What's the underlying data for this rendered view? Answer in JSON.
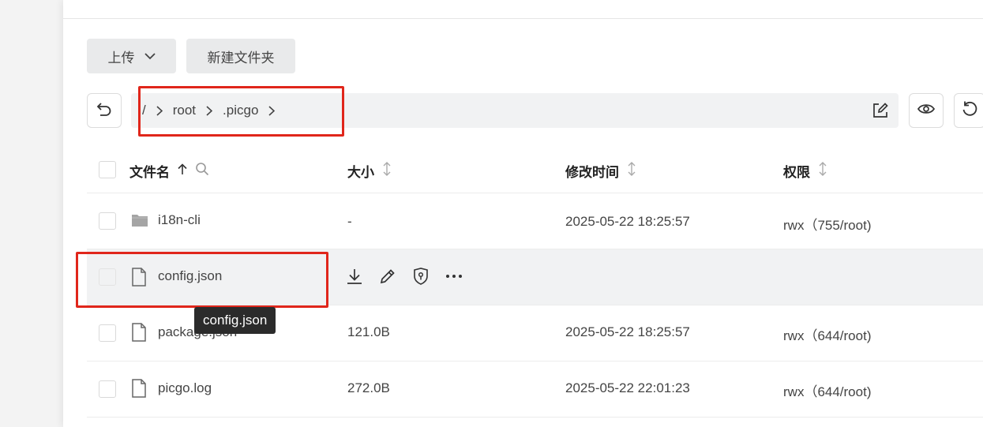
{
  "toolbar": {
    "upload_label": "上传",
    "new_folder_label": "新建文件夹"
  },
  "path": {
    "root": "/",
    "segments": [
      "root",
      ".picgo"
    ]
  },
  "table": {
    "headers": {
      "name": "文件名",
      "size": "大小",
      "modified": "修改时间",
      "permission": "权限"
    },
    "rows": [
      {
        "name": "i18n-cli",
        "type": "folder",
        "size": "-",
        "modified": "2025-05-22 18:25:57",
        "permission": "rwx（755/root)"
      },
      {
        "name": "config.json",
        "type": "file",
        "size": "",
        "modified": "",
        "permission": "",
        "hovered": true
      },
      {
        "name": "package.json",
        "type": "file",
        "size": "121.0B",
        "modified": "2025-05-22 18:25:57",
        "permission": "rwx（644/root)"
      },
      {
        "name": "picgo.log",
        "type": "file",
        "size": "272.0B",
        "modified": "2025-05-22 22:01:23",
        "permission": "rwx（644/root)"
      }
    ]
  },
  "tooltip": {
    "text": "config.json"
  },
  "icons": {
    "back": "undo-icon",
    "edit_path": "edit-icon",
    "view": "eye-icon",
    "refresh": "refresh-icon",
    "download": "download-icon",
    "rename": "pencil-icon",
    "permission": "shield-icon",
    "more": "more-icon"
  },
  "colors": {
    "highlight": "#e0261b",
    "hover_row": "#f1f2f3",
    "tooltip_bg": "#2b2b2b"
  }
}
